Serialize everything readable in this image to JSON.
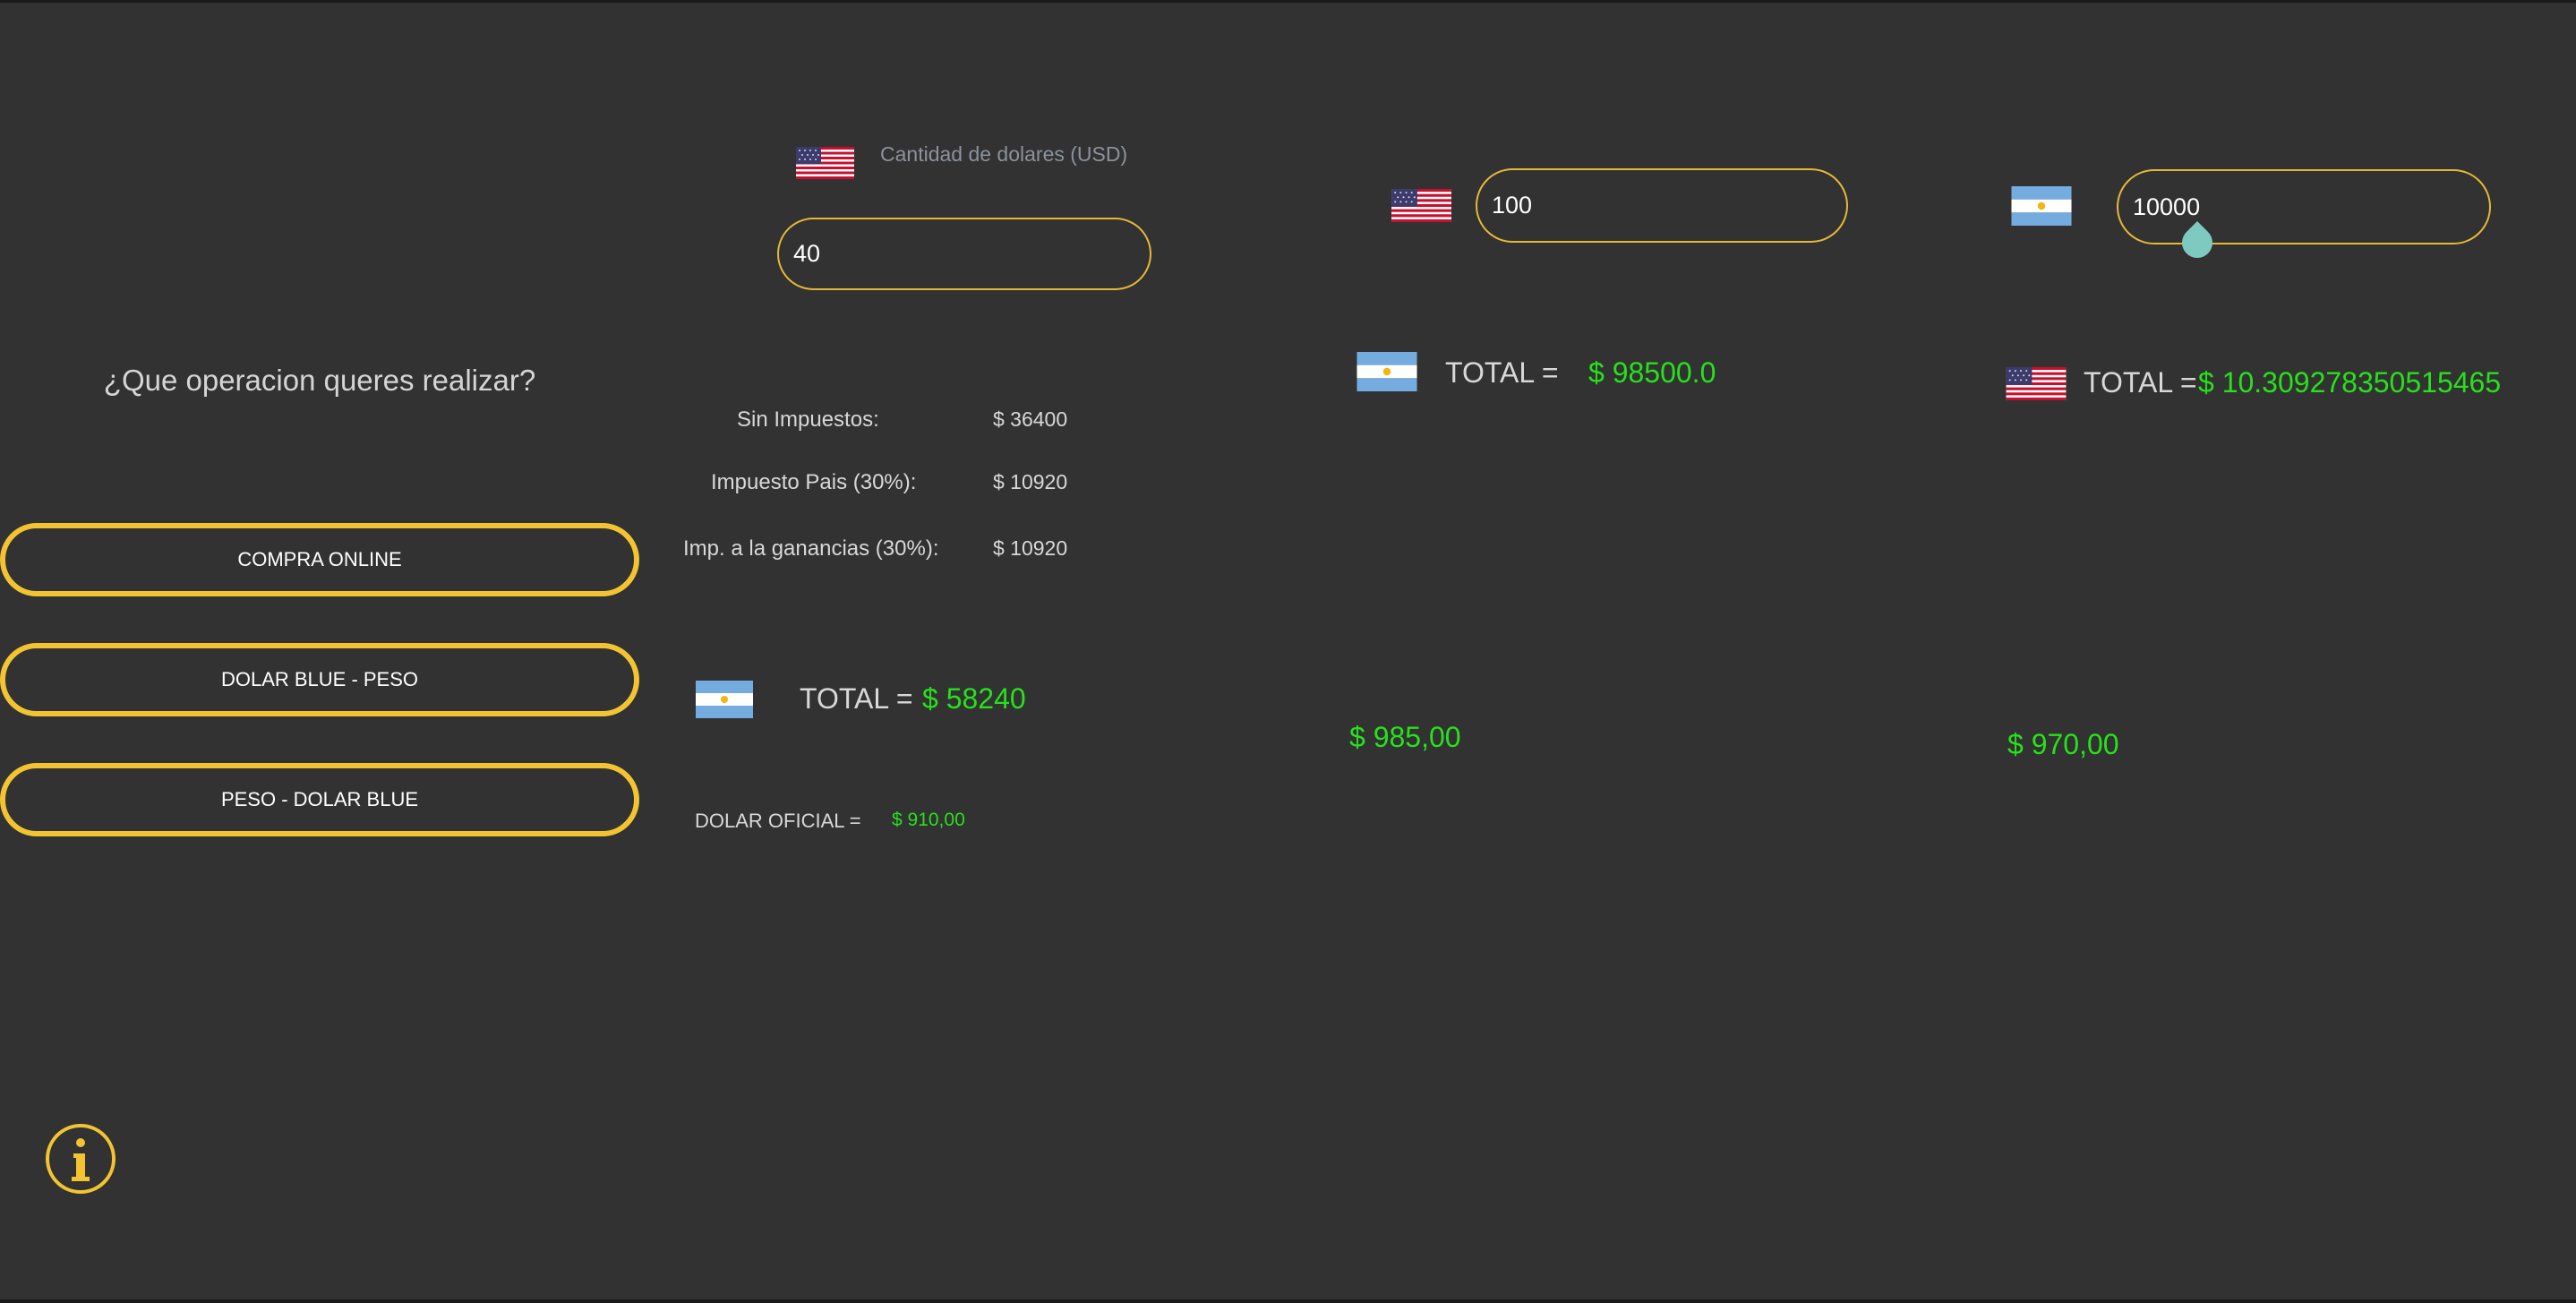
{
  "menu": {
    "question": "¿Que operacion queres realizar?",
    "buttons": [
      "COMPRA ONLINE",
      "DOLAR BLUE - PESO",
      "PESO - DOLAR BLUE"
    ]
  },
  "compra_online": {
    "input_label": "Cantidad de dolares (USD)",
    "input_value": "40",
    "rows": [
      {
        "label": "Sin Impuestos:",
        "value": "$ 36400"
      },
      {
        "label": "Impuesto Pais (30%):",
        "value": "$ 10920"
      },
      {
        "label": "Imp. a la ganancias (30%):",
        "value": "$ 10920"
      }
    ],
    "total_label": "TOTAL =",
    "total_value": "$ 58240",
    "oficial_label": "DOLAR OFICIAL =",
    "oficial_value": "$ 910,00"
  },
  "blue_peso": {
    "input_value": "100",
    "total_label": "TOTAL =",
    "total_value": "$ 98500.0",
    "rate": "$ 985,00"
  },
  "peso_blue": {
    "input_value": "10000",
    "total_label": "TOTAL =",
    "total_value": "$ 10.309278350515465",
    "rate": "$ 970,00"
  },
  "icons": {
    "info": "info-icon",
    "usa": "usa-flag-icon",
    "argentina": "argentina-flag-icon"
  },
  "colors": {
    "background": "#323232",
    "accent": "#f2c432",
    "value_green": "#27e11b",
    "slider_thumb": "#7ec9c0"
  }
}
